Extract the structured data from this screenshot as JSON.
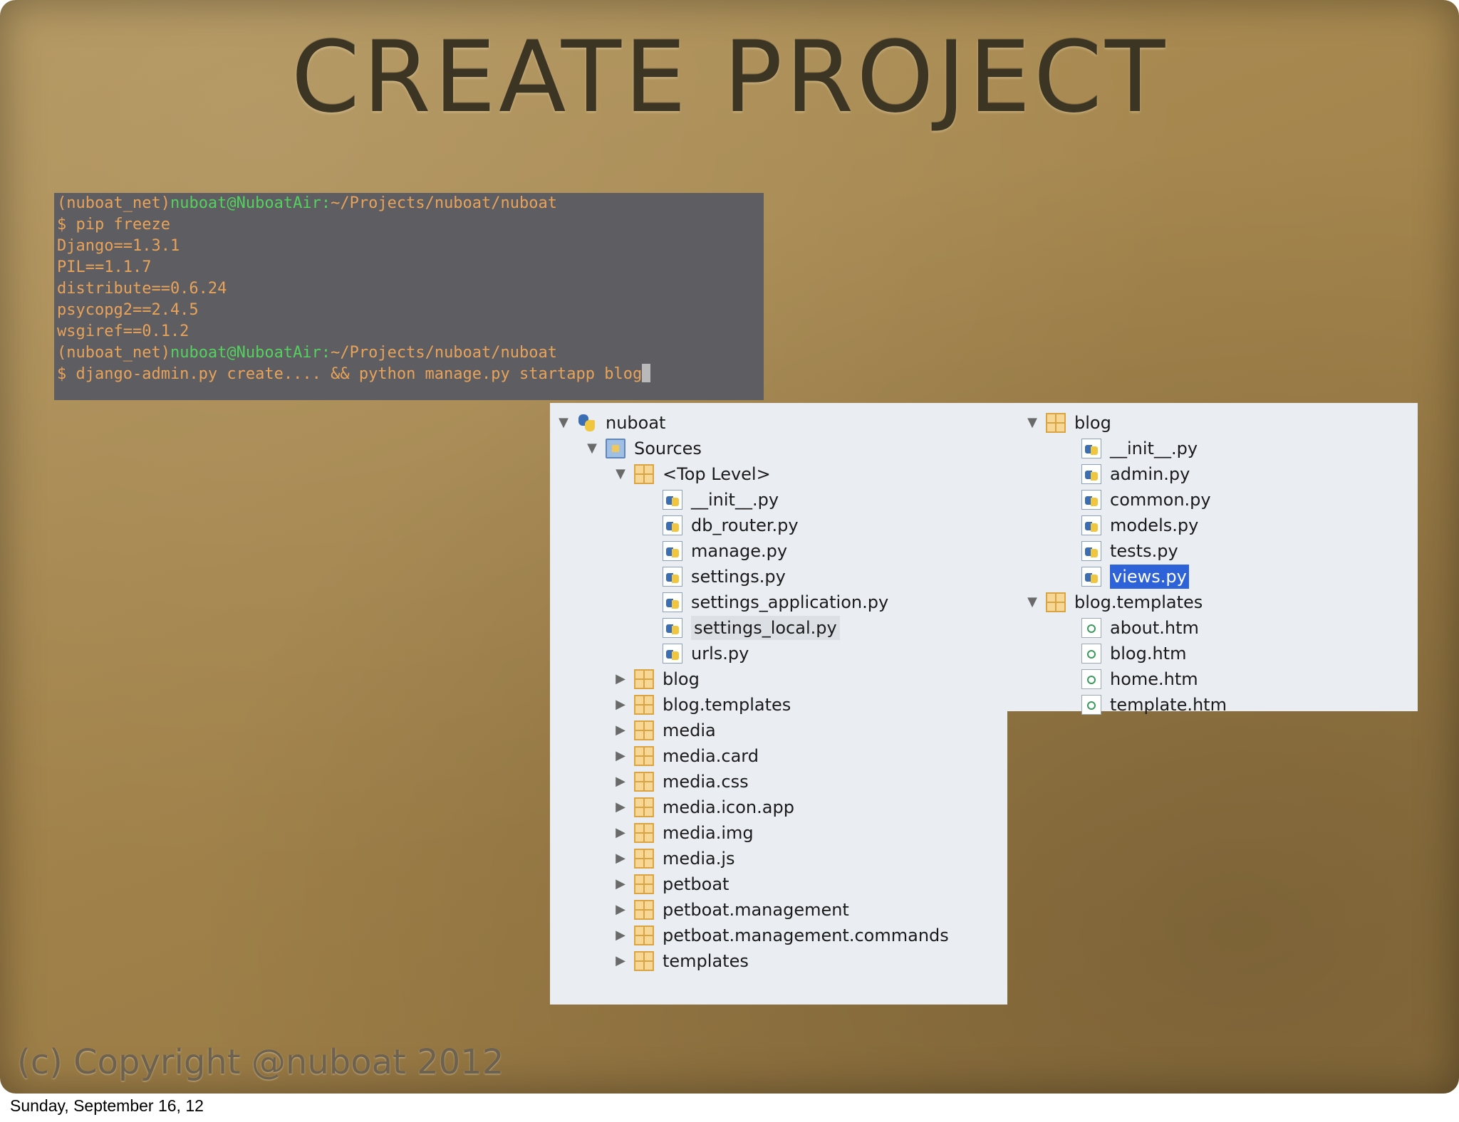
{
  "slide": {
    "title": "CREATE PROJECT",
    "copyright": "(c) Copyright @nuboat 2012",
    "footer_date": "Sunday, September 16, 12"
  },
  "terminal": {
    "lines": [
      {
        "prefix": "(nuboat_net)",
        "host": "nuboat@NuboatAir:",
        "path": "~/Projects/nuboat/nuboat"
      },
      {
        "text": "$ pip freeze"
      },
      {
        "text": "Django==1.3.1"
      },
      {
        "text": "PIL==1.1.7"
      },
      {
        "text": "distribute==0.6.24"
      },
      {
        "text": "psycopg2==2.4.5"
      },
      {
        "text": "wsgiref==0.1.2"
      },
      {
        "prefix": "(nuboat_net)",
        "host": "nuboat@NuboatAir:",
        "path": "~/Projects/nuboat/nuboat"
      },
      {
        "text": "$ django-admin.py create.... && python manage.py startapp blog"
      }
    ]
  },
  "tree_left": {
    "root": "nuboat",
    "sources": "Sources",
    "top_level": "<Top Level>",
    "top_level_files": [
      "__init__.py",
      "db_router.py",
      "manage.py",
      "settings.py",
      "settings_application.py",
      "settings_local.py",
      "urls.py"
    ],
    "packages": [
      "blog",
      "blog.templates",
      "media",
      "media.card",
      "media.css",
      "media.icon.app",
      "media.img",
      "media.js",
      "petboat",
      "petboat.management",
      "petboat.management.commands",
      "templates"
    ]
  },
  "tree_right": {
    "blog": "blog",
    "blog_files": [
      "__init__.py",
      "admin.py",
      "common.py",
      "models.py",
      "tests.py",
      "views.py"
    ],
    "blog_templates": "blog.templates",
    "template_files": [
      "about.htm",
      "blog.htm",
      "home.htm",
      "template.htm"
    ],
    "selected": "views.py"
  },
  "colors": {
    "terminal_bg": "#5e5d61",
    "terminal_text": "#e8a35a",
    "terminal_host": "#54d15e",
    "selection": "#2d62d9",
    "tree_bg": "#eaedf2"
  }
}
